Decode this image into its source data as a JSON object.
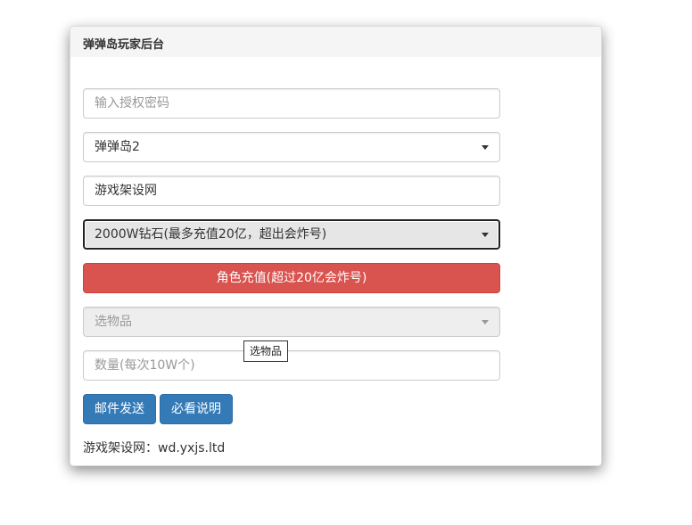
{
  "panel": {
    "title": "弹弹岛玩家后台"
  },
  "form": {
    "password_placeholder": "输入授权密码",
    "server_select_value": "弹弹岛2",
    "role_input_value": "游戏架设网",
    "recharge_select_value": "2000W钻石(最多充值20亿，超出会炸号)",
    "recharge_button_label": "角色充值(超过20亿会炸号)",
    "item_select_value": "选物品",
    "item_tooltip": "选物品",
    "quantity_placeholder": "数量(每次10W个)",
    "mail_button_label": "邮件发送",
    "readme_button_label": "必看说明"
  },
  "footer": {
    "text": "游戏架设网：wd.yxjs.ltd"
  },
  "colors": {
    "danger": "#d9534f",
    "primary": "#337ab7",
    "heading_bg": "#f5f5f5"
  }
}
